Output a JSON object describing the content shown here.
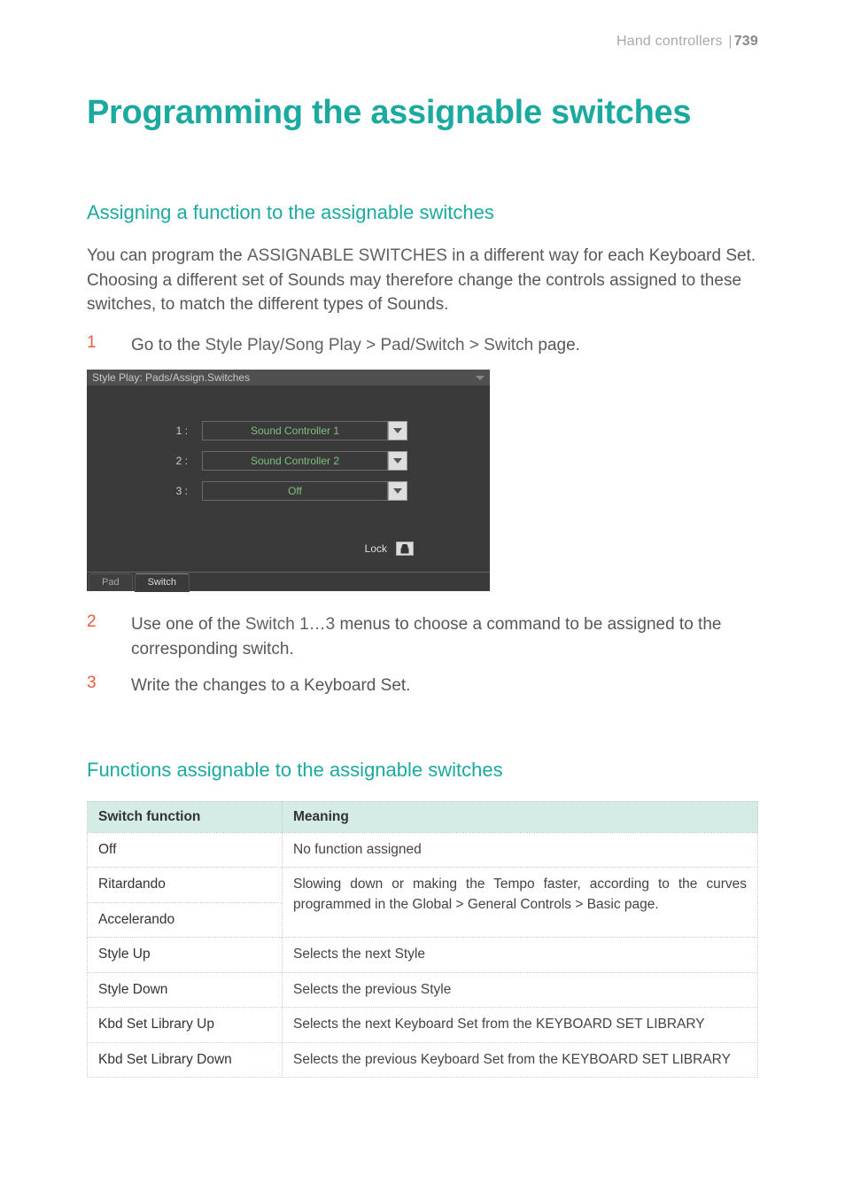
{
  "header": {
    "section": "Hand controllers",
    "page_number": "739"
  },
  "title": "Programming the assignable switches",
  "section1": {
    "heading": "Assigning a function to the assignable switches",
    "intro_pre": "You can program the ",
    "intro_kw": "ASSIGNABLE SWITCHES",
    "intro_post": " in a different way for each Keyboard Set. Choosing a different set of Sounds may therefore change the controls assigned to these switches, to match the different types of Sounds.",
    "steps": [
      {
        "n": "1",
        "pre": "Go to the ",
        "kw": "Style Play/Song Play > Pad/Switch > Switch",
        "post": " page."
      },
      {
        "n": "2",
        "pre": "Use one of the ",
        "kw": "Switch 1…3",
        "post": " menus to choose a command to be assigned to the corresponding switch."
      },
      {
        "n": "3",
        "pre": "Write the changes to a Keyboard Set.",
        "kw": "",
        "post": ""
      }
    ]
  },
  "ui": {
    "title": "Style Play: Pads/Assign.Switches",
    "rows": [
      {
        "label": "1 :",
        "value": "Sound Controller 1"
      },
      {
        "label": "2 :",
        "value": "Sound Controller 2"
      },
      {
        "label": "3 :",
        "value": "Off"
      }
    ],
    "lock_label": "Lock",
    "tabs": {
      "pad": "Pad",
      "switch": "Switch"
    }
  },
  "section2": {
    "heading": "Functions assignable to the assignable switches",
    "th1": "Switch function",
    "th2": "Meaning",
    "rows": [
      {
        "f": "Off",
        "m": "No function assigned"
      },
      {
        "f": "Ritardando",
        "m": "Slowing down or making the Tempo faster, according to the curves programmed in the Global > General Controls > Basic page."
      },
      {
        "f": "Accelerando",
        "m": ""
      },
      {
        "f": "Style Up",
        "m": "Selects the next Style"
      },
      {
        "f": "Style Down",
        "m": "Selects the previous Style"
      },
      {
        "f": "Kbd Set Library Up",
        "m": "Selects the next Keyboard Set from the KEYBOARD SET LIBRARY"
      },
      {
        "f": "Kbd Set Library Down",
        "m": "Selects the previous Keyboard Set from the KEYBOARD SET LIBRARY"
      }
    ]
  }
}
